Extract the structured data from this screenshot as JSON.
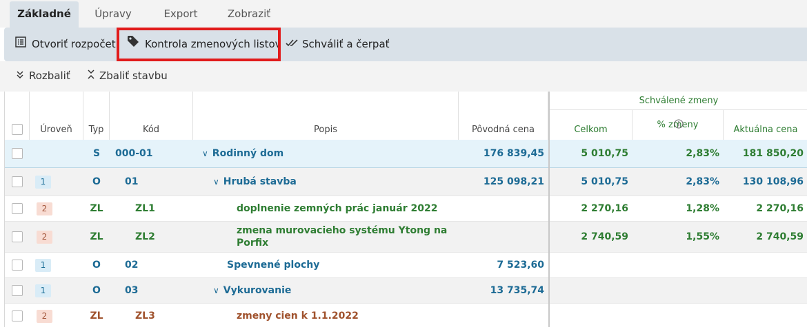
{
  "tabs": [
    "Základné",
    "Úpravy",
    "Export",
    "Zobraziť"
  ],
  "toolbar": {
    "open_budget": "Otvoriť rozpočet",
    "check_change_lists": "Kontrola zmenových listov",
    "approve_draw": "Schváliť a čerpať"
  },
  "subbar": {
    "expand": "Rozbaliť",
    "collapse": "Zbaliť stavbu"
  },
  "table": {
    "group_header": "Schválené zmeny",
    "columns": {
      "level": "Úroveň",
      "type": "Typ",
      "code": "Kód",
      "desc": "Popis",
      "orig_price": "Pôvodná cena",
      "total": "Celkom",
      "pct": "% zmeny",
      "current": "Aktuálna cena"
    },
    "rows": [
      {
        "level": "",
        "type": "S",
        "code": "000-01",
        "desc": "Rodinný dom",
        "orig": "176 839,45",
        "total": "5 010,75",
        "pct": "2,83%",
        "current": "181 850,20"
      },
      {
        "level": "1",
        "type": "O",
        "code": "01",
        "desc": "Hrubá stavba",
        "orig": "125 098,21",
        "total": "5 010,75",
        "pct": "2,83%",
        "current": "130 108,96"
      },
      {
        "level": "2",
        "type": "ZL",
        "code": "ZL1",
        "desc": "doplnenie zemných prác január 2022",
        "orig": "",
        "total": "2 270,16",
        "pct": "1,28%",
        "current": "2 270,16"
      },
      {
        "level": "2",
        "type": "ZL",
        "code": "ZL2",
        "desc": "zmena murovacieho systému Ytong na Porfix",
        "orig": "",
        "total": "2 740,59",
        "pct": "1,55%",
        "current": "2 740,59"
      },
      {
        "level": "1",
        "type": "O",
        "code": "02",
        "desc": "Spevnené plochy",
        "orig": "7 523,60",
        "total": "",
        "pct": "",
        "current": ""
      },
      {
        "level": "1",
        "type": "O",
        "code": "03",
        "desc": "Vykurovanie",
        "orig": "13 735,74",
        "total": "",
        "pct": "",
        "current": ""
      },
      {
        "level": "2",
        "type": "ZL",
        "code": "ZL3",
        "desc": "zmeny cien k 1.1.2022",
        "orig": "",
        "total": "",
        "pct": "",
        "current": ""
      }
    ]
  },
  "colors": {
    "blue": "#1d6b95",
    "green": "#2e7d32",
    "brown": "#a0522d",
    "highlight": "#e11b1b"
  }
}
